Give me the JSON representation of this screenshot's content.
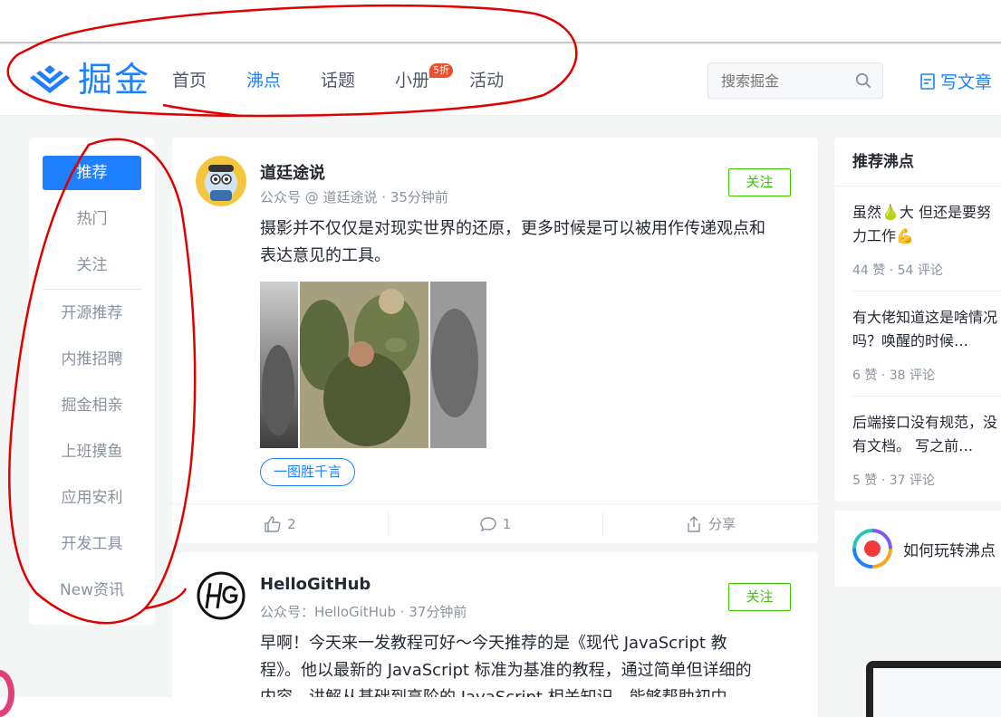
{
  "brand": {
    "logo_text": "掘金",
    "color": "#1e80ff"
  },
  "nav": {
    "items": [
      {
        "label": "首页",
        "active": false
      },
      {
        "label": "沸点",
        "active": true
      },
      {
        "label": "话题",
        "active": false
      },
      {
        "label": "小册",
        "active": false,
        "badge": "5折"
      },
      {
        "label": "活动",
        "active": false
      }
    ]
  },
  "search": {
    "placeholder": "搜索掘金"
  },
  "write_button": {
    "label": "写文章"
  },
  "sidebar": {
    "items": [
      {
        "label": "推荐",
        "active": true
      },
      {
        "label": "热门"
      },
      {
        "label": "关注"
      },
      {
        "label": "开源推荐"
      },
      {
        "label": "内推招聘"
      },
      {
        "label": "掘金相亲"
      },
      {
        "label": "上班摸鱼"
      },
      {
        "label": "应用安利"
      },
      {
        "label": "开发工具"
      },
      {
        "label": "New资讯"
      }
    ]
  },
  "posts": [
    {
      "author": "道廷途说",
      "meta": "公众号 @ 道廷途说 · 35分钟前",
      "follow_label": "关注",
      "content": "摄影并不仅仅是对现实世界的还原，更多时候是可以被用作传递观点和表达意见的工具。",
      "topic": "一图胜千言",
      "likes": "2",
      "comments": "1",
      "share_label": "分享"
    },
    {
      "author": "HelloGitHub",
      "meta": "公众号：HelloGitHub · 37分钟前",
      "follow_label": "关注",
      "content": "早啊！今天来一发教程可好～今天推荐的是《现代 JavaScript 教程》。他以最新的 JavaScript 标准为基准的教程，通过简单但详细的内容，讲解从基础到高阶的 JavaScript 相关知识，能够帮助初中"
    }
  ],
  "hot": {
    "title": "推荐沸点",
    "items": [
      {
        "text": "虽然🍐大 但还是要努力工作💪",
        "stats": "44 赞 · 54 评论"
      },
      {
        "text": "有大佬知道这是啥情况吗？唤醒的时候…",
        "stats": "6 赞 · 38 评论"
      },
      {
        "text": "后端接口没有规范，没有文档。 写之前…",
        "stats": "5 赞 · 37 评论"
      }
    ]
  },
  "guide": {
    "label": "如何玩转沸点"
  }
}
